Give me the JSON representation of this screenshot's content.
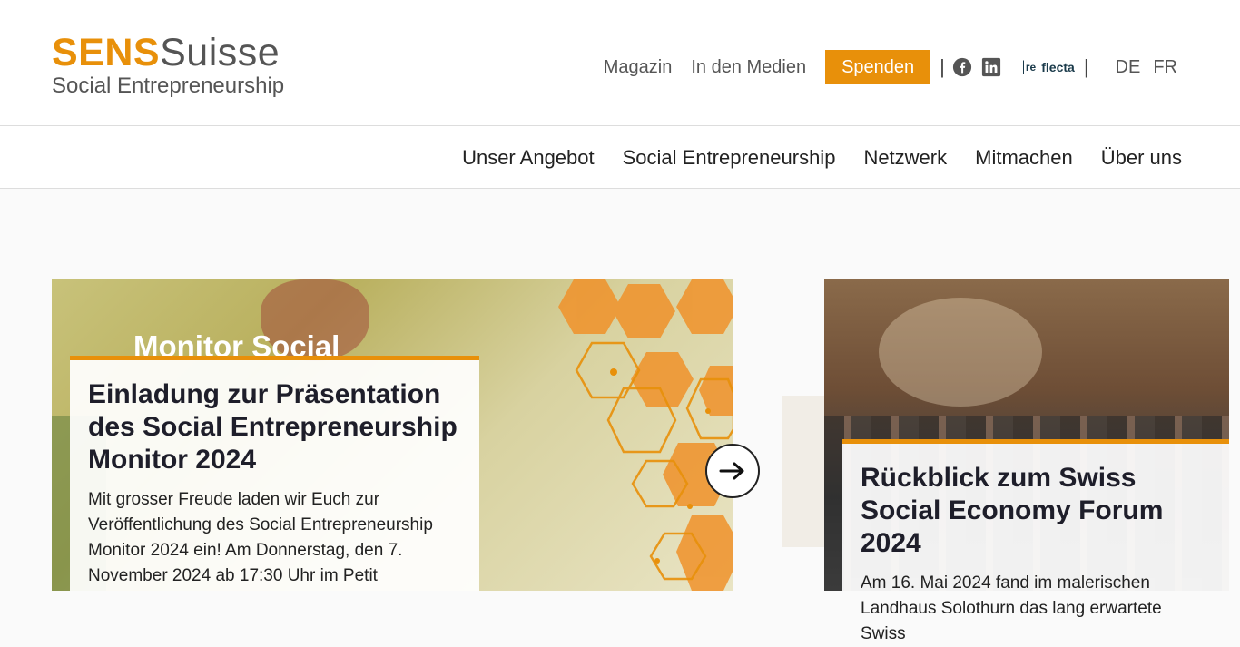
{
  "logo": {
    "brand_bold": "SENS",
    "brand_light": "Suisse",
    "tagline": "Social Entrepreneurship"
  },
  "utility_nav": {
    "links": [
      "Magazin",
      "In den Medien"
    ],
    "donate_label": "Spenden",
    "separator": "|",
    "social_icons": [
      "facebook-icon",
      "linkedin-icon"
    ],
    "reflecta_bracket": "re",
    "reflecta_text": "flecta",
    "languages": [
      "DE",
      "FR"
    ]
  },
  "main_nav": {
    "items": [
      "Unser Angebot",
      "Social Entrepreneurship",
      "Netzwerk",
      "Mitmachen",
      "Über uns"
    ]
  },
  "cards": [
    {
      "image_text": "Monitor Social",
      "title": "Einladung zur Präsentation des Social Entrepreneurship Monitor 2024",
      "text": "Mit grosser Freude laden wir Euch zur Veröffentlichung des Social Entrepreneurship Monitor 2024 ein! Am Donnerstag, den 7. November 2024 ab 17:30 Uhr im Petit"
    },
    {
      "title": "Rückblick zum Swiss Social Economy Forum 2024",
      "text": "Am 16. Mai 2024 fand im malerischen Landhaus Solothurn das lang erwartete Swiss"
    }
  ],
  "colors": {
    "accent": "#e8900a",
    "text_dark": "#1e1e2a",
    "muted": "#555555"
  }
}
